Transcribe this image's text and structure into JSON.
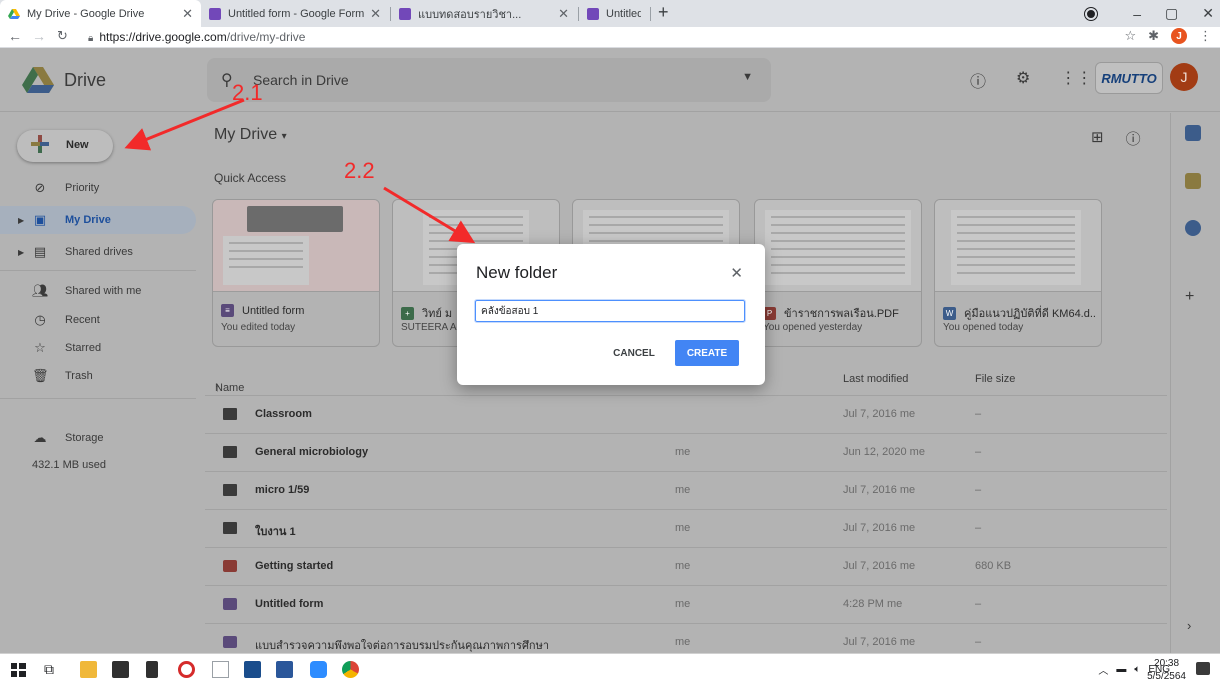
{
  "browser": {
    "tabs": [
      {
        "title": "My Drive - Google Drive",
        "active": true
      },
      {
        "title": "Untitled form - Google Forms",
        "active": false
      },
      {
        "title": "แบบทดสอบรายวิชา...",
        "active": false
      },
      {
        "title": "Untitled form - Google Forms",
        "active": false
      }
    ],
    "url_host": "https://drive.google.com",
    "url_path": "/drive/my-drive",
    "profile_initial": "J"
  },
  "header": {
    "app_name": "Drive",
    "search_placeholder": "Search in Drive",
    "org_logo_text": "RMUTTO",
    "avatar_initial": "J"
  },
  "sidebar": {
    "new_label": "New",
    "items": [
      {
        "label": "Priority",
        "icon": "priority-icon"
      },
      {
        "label": "My Drive",
        "icon": "my-drive-icon"
      },
      {
        "label": "Shared drives",
        "icon": "shared-drives-icon"
      },
      {
        "label": "Shared with me",
        "icon": "people-icon"
      },
      {
        "label": "Recent",
        "icon": "clock-icon"
      },
      {
        "label": "Starred",
        "icon": "star-icon"
      },
      {
        "label": "Trash",
        "icon": "trash-icon"
      },
      {
        "label": "Storage",
        "icon": "cloud-icon"
      }
    ],
    "storage_used": "432.1 MB used"
  },
  "main": {
    "title": "My Drive",
    "quick_access_title": "Quick Access",
    "cards": [
      {
        "name": "Untitled form",
        "sub": "You edited today",
        "type": "form",
        "color": "#7248b9"
      },
      {
        "name": "วิทย์ ม",
        "sub": "SUTEERA A",
        "type": "sheet",
        "color": "#188038"
      },
      {
        "name": "",
        "sub": "",
        "type": "doc",
        "color": "#4285f4"
      },
      {
        "name": "ข้าราชการพลเรือน.PDF",
        "sub": "You opened yesterday",
        "type": "pdf",
        "color": "#d93025"
      },
      {
        "name": "คู่มือแนวปฏิบัติที่ดี KM64.d...",
        "sub": "You opened today",
        "type": "word",
        "color": "#4285f4"
      }
    ],
    "columns": {
      "name": "Name",
      "modified": "Last modified",
      "size": "File size"
    },
    "rows": [
      {
        "name": "Classroom",
        "owner": "",
        "modified": "Jul 7, 2016 me",
        "size": "–"
      },
      {
        "name": "General microbiology",
        "owner": "me",
        "modified": "Jun 12, 2020 me",
        "size": "–"
      },
      {
        "name": "micro 1/59",
        "owner": "me",
        "modified": "Jul 7, 2016 me",
        "size": "–"
      },
      {
        "name": "ใบงาน 1",
        "owner": "me",
        "modified": "Jul 7, 2016 me",
        "size": "–"
      },
      {
        "name": "Getting started",
        "owner": "me",
        "modified": "Jul 7, 2016 me",
        "size": "680 KB"
      },
      {
        "name": "Untitled form",
        "owner": "me",
        "modified": "4:28 PM me",
        "size": "–"
      },
      {
        "name": "แบบสำรวจความพึงพอใจต่อการอบรมประกันคุณภาพการศึกษา",
        "owner": "me",
        "modified": "Jul 7, 2016 me",
        "size": "–"
      }
    ]
  },
  "dialog": {
    "title": "New folder",
    "input_value": "คลังข้อสอบ 1",
    "cancel_label": "CANCEL",
    "create_label": "CREATE"
  },
  "annotations": {
    "label_1": "2.1",
    "label_2": "2.2",
    "color": "#f22a2a"
  },
  "taskbar": {
    "lang": "ENG",
    "time": "20:38",
    "date": "5/5/2564"
  }
}
